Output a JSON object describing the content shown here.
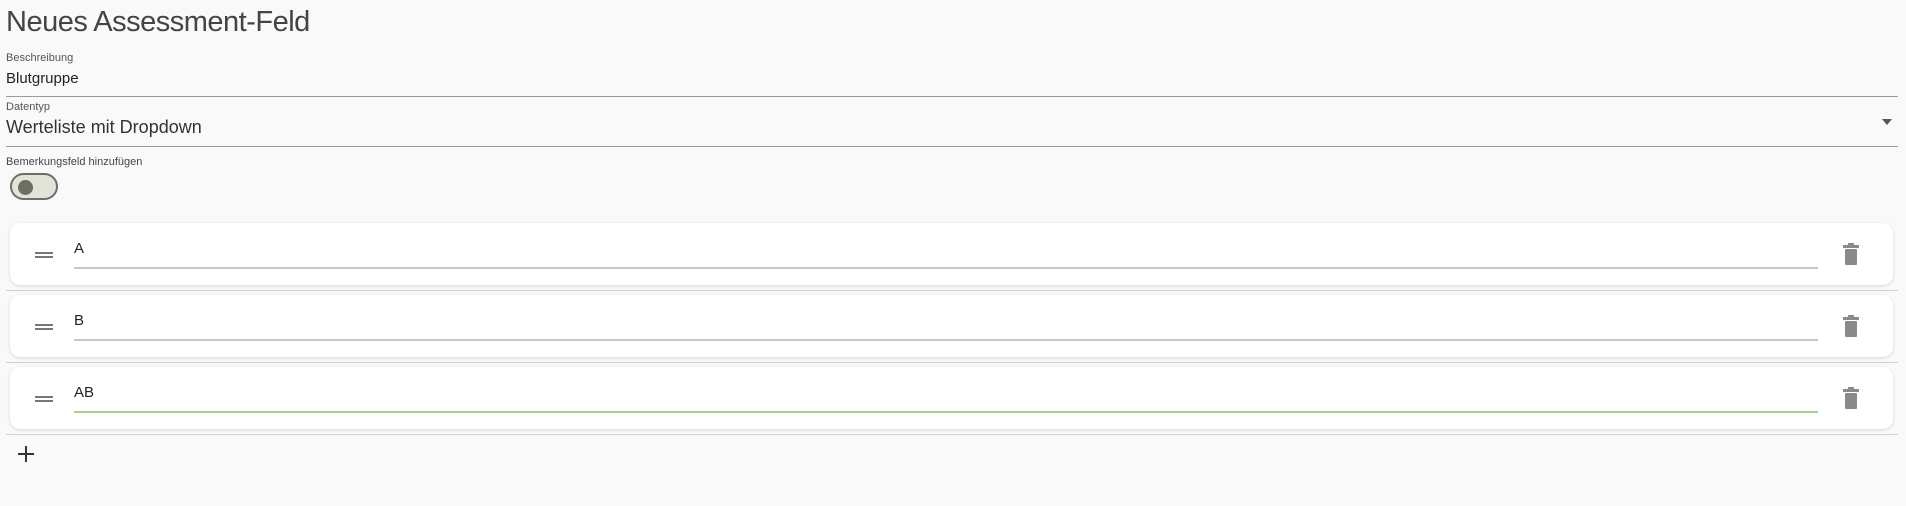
{
  "page": {
    "title": "Neues Assessment-Feld"
  },
  "fields": {
    "description": {
      "label": "Beschreibung",
      "value": "Blutgruppe"
    },
    "datatype": {
      "label": "Datentyp",
      "value": "Werteliste mit Dropdown"
    },
    "remark_toggle": {
      "label": "Bemerkungsfeld hinzufügen",
      "checked": false
    }
  },
  "options": [
    {
      "value": "A",
      "focused": false
    },
    {
      "value": "B",
      "focused": false
    },
    {
      "value": "AB",
      "focused": true
    }
  ],
  "icons": {
    "drag": "drag-handle-icon",
    "delete": "trash-icon",
    "add": "plus-icon",
    "dropdown": "arrow-down-icon"
  },
  "colors": {
    "focus_underline": "#a9cf8e",
    "toggle_track": "#e2e3d9",
    "toggle_outline": "#6b6f64"
  }
}
